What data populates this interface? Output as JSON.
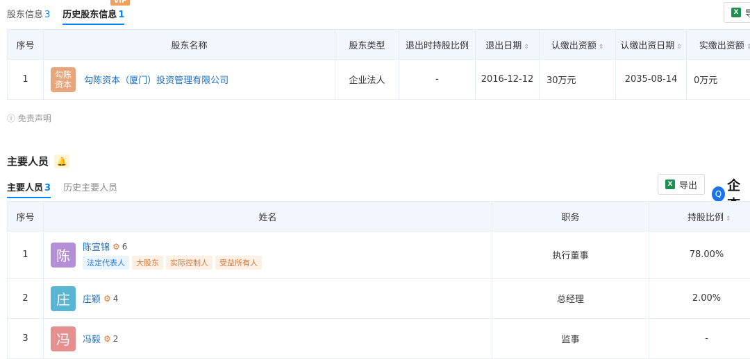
{
  "shareholder_tabs": [
    {
      "label": "股东信息",
      "count": "3"
    },
    {
      "label": "历史股东信息",
      "count": "1",
      "badge": "VIP"
    }
  ],
  "export_label": "导",
  "shareholder_table": {
    "headers": [
      "序号",
      "股东名称",
      "股东类型",
      "退出时持股比例",
      "退出日期",
      "认缴出资额",
      "认缴出资日期",
      "实缴出资额"
    ],
    "rows": [
      {
        "index": "1",
        "logo_text": "勾陈\n资本",
        "name": "勾陈资本（厦门）投资管理有限公司",
        "type": "企业法人",
        "ratio": "-",
        "exit_date": "2016-12-12",
        "subscribed": "30万元",
        "subscribed_date": "2035-08-14",
        "paid": "0万元"
      }
    ]
  },
  "disclaimer": "免责声明",
  "section": {
    "title": "主要人员"
  },
  "personnel_tabs": [
    {
      "label": "主要人员",
      "count": "3"
    },
    {
      "label": "历史主要人员",
      "count": ""
    }
  ],
  "export_button": "导出",
  "brand_text": "企查",
  "personnel_table": {
    "headers": [
      "序号",
      "姓名",
      "职务",
      "持股比例"
    ],
    "rows": [
      {
        "index": "1",
        "avatar": "陈",
        "avatar_color": "#b48fd8",
        "name": "陈宣锦",
        "rel_count": "6",
        "tags": [
          "法定代表人",
          "大股东",
          "实际控制人",
          "受益所有人"
        ],
        "position": "执行董事",
        "ratio": "78.00%"
      },
      {
        "index": "2",
        "avatar": "庄",
        "avatar_color": "#58b5d4",
        "name": "庄颖",
        "rel_count": "4",
        "tags": [],
        "position": "总经理",
        "ratio": "2.00%"
      },
      {
        "index": "3",
        "avatar": "冯",
        "avatar_color": "#e58f8f",
        "name": "冯毅",
        "rel_count": "2",
        "tags": [],
        "position": "监事",
        "ratio": "-"
      }
    ]
  },
  "colors": {
    "accent": "#0084ff",
    "header_bg": "#f1f7fd",
    "vip": "#f0a05a"
  }
}
